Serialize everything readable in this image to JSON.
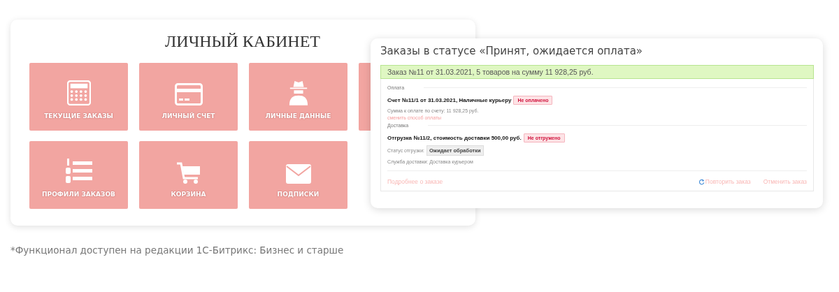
{
  "cabinet": {
    "title": "ЛИЧНЫЙ КАБИНЕТ",
    "tiles": [
      {
        "kind": "calculator",
        "label": "ТЕКУЩИЕ ЗАКАЗЫ"
      },
      {
        "kind": "card",
        "label": "ЛИЧНЫЙ СЧЕТ"
      },
      {
        "kind": "spy",
        "label": "ЛИЧНЫЕ ДАННЫЕ"
      },
      {
        "kind": "blank"
      },
      {
        "kind": "list",
        "label": "ПРОФИЛИ ЗАКАЗОВ"
      },
      {
        "kind": "cart",
        "label": "КОРЗИНА"
      },
      {
        "kind": "envelope",
        "label": "ПОДПИСКИ"
      }
    ]
  },
  "orders": {
    "title": "Заказы в статусе «Принят, ожидается оплата»",
    "order_header": "Заказ №11 от 31.03.2021, 5 товаров на сумму 11 928,25 руб.",
    "payment": {
      "section": "Оплата",
      "heading": "Счет №11/1 от 31.03.2021, Наличные курьеру",
      "badge": "Не оплачено",
      "sum": "Сумма к оплате по счету: 11 928,25 руб.",
      "link": "сменить способ оплаты"
    },
    "delivery": {
      "section": "Доставка",
      "heading": "Отгрузка №11/2, стоимость доставки 500,00 руб.",
      "badge": "Не отгружено",
      "status_label": "Статус отгрузки:",
      "status": "Ожидает обработки",
      "service": "Служба доставки: Доставка курьером"
    },
    "actions": {
      "details": "Подробнее о заказе",
      "repeat": "Повторить заказ",
      "cancel": "Отменить заказ"
    }
  },
  "footnote": "*Функционал доступен на редакции 1С-Битрикс: Бизнес и старше"
}
